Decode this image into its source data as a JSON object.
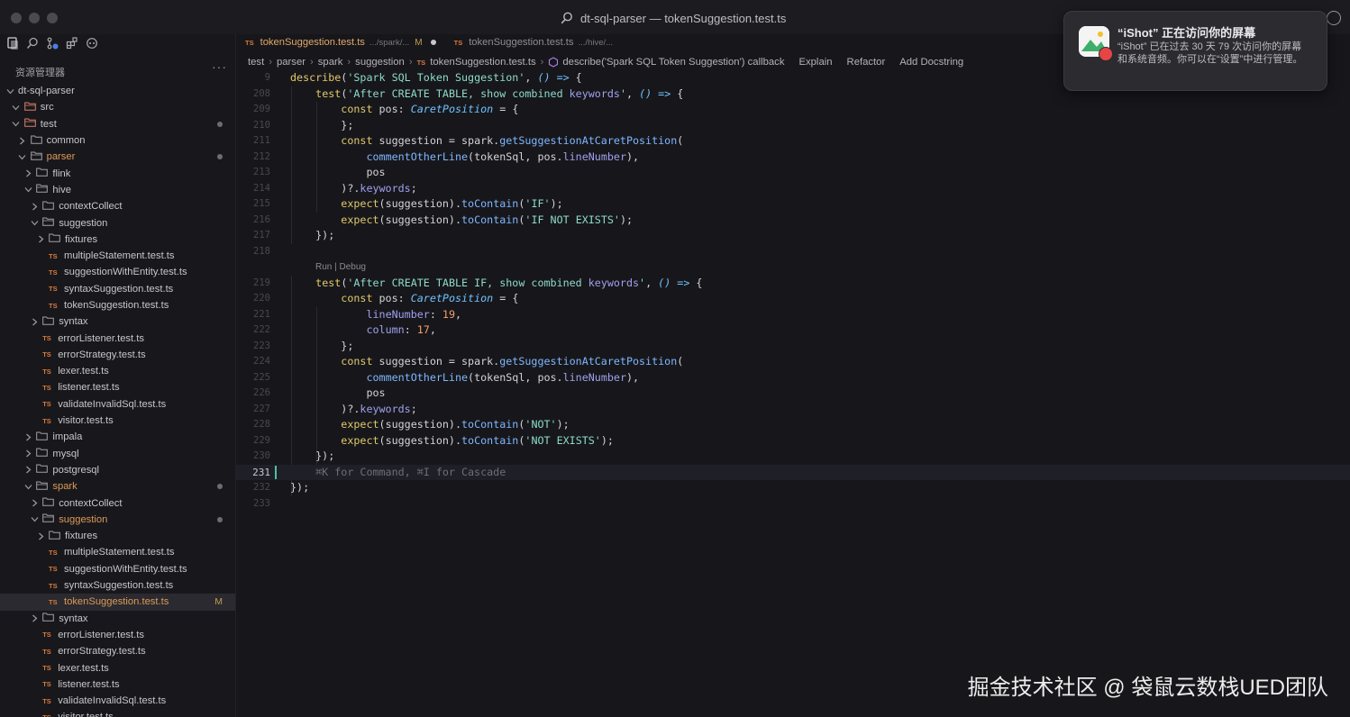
{
  "window": {
    "title": "dt-sql-parser — tokenSuggestion.test.ts"
  },
  "colors": {
    "accent_orange": "#dd9a57",
    "ts_icon": "#d87a3b",
    "cursor": "#4fc1a6",
    "toast_badge": "#e64545"
  },
  "activity_icons": [
    "explorer-icon",
    "search-icon",
    "source-control-icon",
    "extensions-icon",
    "copilot-icon"
  ],
  "explorer": {
    "title": "资源管理器",
    "more": "···",
    "tree": [
      {
        "label": "dt-sql-parser",
        "depth": 0,
        "kind": "folder-open",
        "bare": true
      },
      {
        "label": "src",
        "depth": 1,
        "kind": "folder-open",
        "special": true
      },
      {
        "label": "test",
        "depth": 1,
        "kind": "folder-open",
        "special": true,
        "dot": true
      },
      {
        "label": "common",
        "depth": 2,
        "kind": "folder-closed"
      },
      {
        "label": "parser",
        "depth": 2,
        "kind": "folder-open",
        "orange": true,
        "dot": true
      },
      {
        "label": "flink",
        "depth": 3,
        "kind": "folder-closed"
      },
      {
        "label": "hive",
        "depth": 3,
        "kind": "folder-open"
      },
      {
        "label": "contextCollect",
        "depth": 4,
        "kind": "folder-closed"
      },
      {
        "label": "suggestion",
        "depth": 4,
        "kind": "folder-open"
      },
      {
        "label": "fixtures",
        "depth": 5,
        "kind": "folder-closed"
      },
      {
        "label": "multipleStatement.test.ts",
        "depth": 5,
        "kind": "ts"
      },
      {
        "label": "suggestionWithEntity.test.ts",
        "depth": 5,
        "kind": "ts"
      },
      {
        "label": "syntaxSuggestion.test.ts",
        "depth": 5,
        "kind": "ts"
      },
      {
        "label": "tokenSuggestion.test.ts",
        "depth": 5,
        "kind": "ts"
      },
      {
        "label": "syntax",
        "depth": 4,
        "kind": "folder-closed"
      },
      {
        "label": "errorListener.test.ts",
        "depth": 4,
        "kind": "ts"
      },
      {
        "label": "errorStrategy.test.ts",
        "depth": 4,
        "kind": "ts"
      },
      {
        "label": "lexer.test.ts",
        "depth": 4,
        "kind": "ts"
      },
      {
        "label": "listener.test.ts",
        "depth": 4,
        "kind": "ts"
      },
      {
        "label": "validateInvalidSql.test.ts",
        "depth": 4,
        "kind": "ts"
      },
      {
        "label": "visitor.test.ts",
        "depth": 4,
        "kind": "ts"
      },
      {
        "label": "impala",
        "depth": 3,
        "kind": "folder-closed"
      },
      {
        "label": "mysql",
        "depth": 3,
        "kind": "folder-closed"
      },
      {
        "label": "postgresql",
        "depth": 3,
        "kind": "folder-closed"
      },
      {
        "label": "spark",
        "depth": 3,
        "kind": "folder-open",
        "orange": true,
        "dot": true
      },
      {
        "label": "contextCollect",
        "depth": 4,
        "kind": "folder-closed"
      },
      {
        "label": "suggestion",
        "depth": 4,
        "kind": "folder-open",
        "orange": true,
        "dot": true
      },
      {
        "label": "fixtures",
        "depth": 5,
        "kind": "folder-closed"
      },
      {
        "label": "multipleStatement.test.ts",
        "depth": 5,
        "kind": "ts"
      },
      {
        "label": "suggestionWithEntity.test.ts",
        "depth": 5,
        "kind": "ts"
      },
      {
        "label": "syntaxSuggestion.test.ts",
        "depth": 5,
        "kind": "ts"
      },
      {
        "label": "tokenSuggestion.test.ts",
        "depth": 5,
        "kind": "ts",
        "orange": true,
        "selected": true,
        "mod": "M"
      },
      {
        "label": "syntax",
        "depth": 4,
        "kind": "folder-closed"
      },
      {
        "label": "errorListener.test.ts",
        "depth": 4,
        "kind": "ts"
      },
      {
        "label": "errorStrategy.test.ts",
        "depth": 4,
        "kind": "ts"
      },
      {
        "label": "lexer.test.ts",
        "depth": 4,
        "kind": "ts"
      },
      {
        "label": "listener.test.ts",
        "depth": 4,
        "kind": "ts"
      },
      {
        "label": "validateInvalidSql.test.ts",
        "depth": 4,
        "kind": "ts"
      },
      {
        "label": "visitor.test.ts",
        "depth": 4,
        "kind": "ts"
      }
    ]
  },
  "tabs": [
    {
      "label": "tokenSuggestion.test.ts",
      "path": ".../spark/...",
      "modified": "M",
      "active": true
    },
    {
      "label": "tokenSuggestion.test.ts",
      "path": ".../hive/...",
      "active": false
    }
  ],
  "breadcrumb": {
    "items": [
      "test",
      "parser",
      "spark",
      "suggestion",
      "tokenSuggestion.test.ts",
      "describe('Spark SQL Token Suggestion') callback"
    ],
    "actions": [
      "Explain",
      "Refactor",
      "Add Docstring"
    ]
  },
  "code": {
    "lines": [
      {
        "n": "9",
        "text": "describe('Spark SQL Token Suggestion', () => {"
      },
      {
        "n": "208",
        "text": "    test('After CREATE TABLE, show combined keywords', () => {"
      },
      {
        "n": "209",
        "text": "        const pos: CaretPosition = {"
      },
      {
        "n": "210",
        "text": "        };"
      },
      {
        "n": "211",
        "text": "        const suggestion = spark.getSuggestionAtCaretPosition("
      },
      {
        "n": "212",
        "text": "            commentOtherLine(tokenSql, pos.lineNumber),"
      },
      {
        "n": "213",
        "text": "            pos"
      },
      {
        "n": "214",
        "text": "        )?.keywords;"
      },
      {
        "n": "215",
        "text": "        expect(suggestion).toContain('IF');"
      },
      {
        "n": "216",
        "text": "        expect(suggestion).toContain('IF NOT EXISTS');"
      },
      {
        "n": "217",
        "text": "    });"
      },
      {
        "n": "218",
        "text": ""
      },
      {
        "n": "219",
        "text": "    test('After CREATE TABLE IF, show combined keywords', () => {"
      },
      {
        "n": "220",
        "text": "        const pos: CaretPosition = {"
      },
      {
        "n": "221",
        "text": "            lineNumber: 19,"
      },
      {
        "n": "222",
        "text": "            column: 17,"
      },
      {
        "n": "223",
        "text": "        };"
      },
      {
        "n": "224",
        "text": "        const suggestion = spark.getSuggestionAtCaretPosition("
      },
      {
        "n": "225",
        "text": "            commentOtherLine(tokenSql, pos.lineNumber),"
      },
      {
        "n": "226",
        "text": "            pos"
      },
      {
        "n": "227",
        "text": "        )?.keywords;"
      },
      {
        "n": "228",
        "text": "        expect(suggestion).toContain('NOT');"
      },
      {
        "n": "229",
        "text": "        expect(suggestion).toContain('NOT EXISTS');"
      },
      {
        "n": "230",
        "text": "    });"
      },
      {
        "n": "231",
        "text": "    ⌘K for Command, ⌘I for Cascade",
        "hint": true,
        "current": true
      },
      {
        "n": "232",
        "text": "});"
      },
      {
        "n": "233",
        "text": ""
      }
    ],
    "codelens": "Run | Debug"
  },
  "notification": {
    "title": "“iShot” 正在访问你的屏幕",
    "body": "“iShot” 已在过去 30 天 79 次访问你的屏幕和系统音频。你可以在“设置”中进行管理。"
  },
  "watermark": "掘金技术社区 @ 袋鼠云数栈UED团队"
}
